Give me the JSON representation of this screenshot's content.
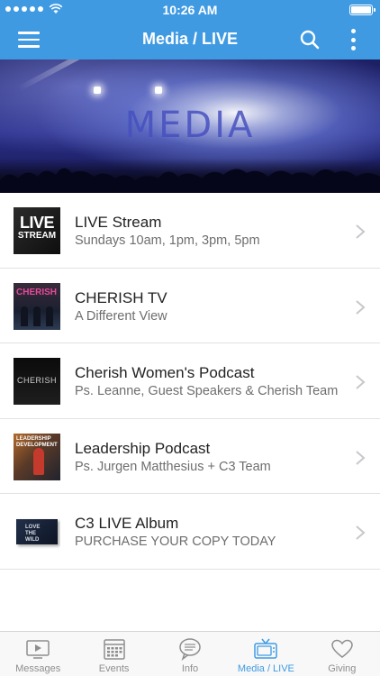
{
  "status": {
    "time": "10:26 AM"
  },
  "nav": {
    "title": "Media / LIVE"
  },
  "banner": {
    "text": "MEDIA"
  },
  "items": [
    {
      "title": "LIVE Stream",
      "subtitle": "Sundays 10am, 1pm, 3pm, 5pm",
      "thumb_text": [
        "LIVE",
        "STREAM"
      ]
    },
    {
      "title": "CHERISH TV",
      "subtitle": "A Different View",
      "thumb_text": "CHERISH"
    },
    {
      "title": "Cherish Women's Podcast",
      "subtitle": "Ps. Leanne, Guest Speakers & Cherish Team",
      "thumb_text": "CHERISH"
    },
    {
      "title": "Leadership Podcast",
      "subtitle": "Ps. Jurgen Matthesius + C3 Team",
      "thumb_text": [
        "LEADERSHIP",
        "DEVELOPMENT"
      ]
    },
    {
      "title": "C3 LIVE Album",
      "subtitle": "PURCHASE YOUR COPY TODAY",
      "thumb_text": [
        "LOVE",
        "THE",
        "WILD"
      ]
    }
  ],
  "tabs": [
    {
      "label": "Messages",
      "icon": "play-screen-icon",
      "active": false
    },
    {
      "label": "Events",
      "icon": "calendar-icon",
      "active": false
    },
    {
      "label": "Info",
      "icon": "chat-bubble-icon",
      "active": false
    },
    {
      "label": "Media / LIVE",
      "icon": "tv-icon",
      "active": true
    },
    {
      "label": "Giving",
      "icon": "heart-icon",
      "active": false
    }
  ],
  "colors": {
    "accent": "#3f9ae2",
    "tab_inactive": "#8e8e8e"
  }
}
